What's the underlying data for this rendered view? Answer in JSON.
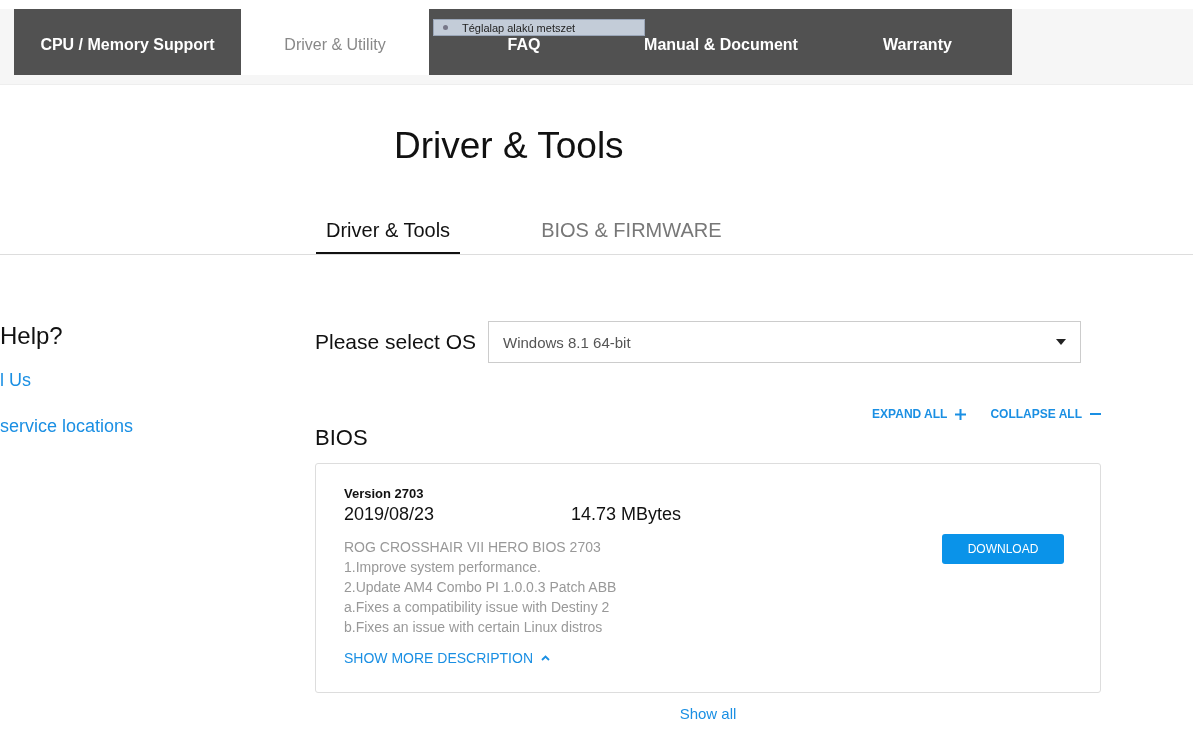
{
  "nav_tabs": [
    {
      "label": "CPU / Memory Support",
      "selected": false
    },
    {
      "label": "Driver & Utility",
      "selected": true
    },
    {
      "label": "FAQ",
      "selected": false
    },
    {
      "label": "Manual & Document",
      "selected": false
    },
    {
      "label": "Warranty",
      "selected": false
    }
  ],
  "tooltip": {
    "text": "Téglalap alakú metszet"
  },
  "page_title": "Driver & Tools",
  "sub_tabs": [
    {
      "label": "Driver & Tools",
      "selected": true
    },
    {
      "label": "BIOS & FIRMWARE",
      "selected": false
    }
  ],
  "sidebar": {
    "heading": "Help?",
    "links": [
      "l Us",
      "service locations"
    ]
  },
  "os_select": {
    "label": "Please select OS",
    "value": "Windows 8.1 64-bit"
  },
  "actions": [
    {
      "label": "EXPAND ALL",
      "kind": "expand"
    },
    {
      "label": "COLLAPSE ALL",
      "kind": "collapse"
    }
  ],
  "section_title": "BIOS",
  "bios_card": {
    "version": "Version 2703",
    "date": "2019/08/23",
    "size": "14.73 MBytes",
    "description": [
      "ROG CROSSHAIR VII HERO BIOS 2703",
      "1.Improve system performance.",
      "2.Update AM4 Combo PI 1.0.0.3 Patch ABB",
      "a.Fixes a compatibility issue with Destiny 2",
      "b.Fixes an issue with certain Linux distros"
    ],
    "show_more": "SHOW MORE DESCRIPTION",
    "download": "DOWNLOAD"
  },
  "show_all": "Show all"
}
